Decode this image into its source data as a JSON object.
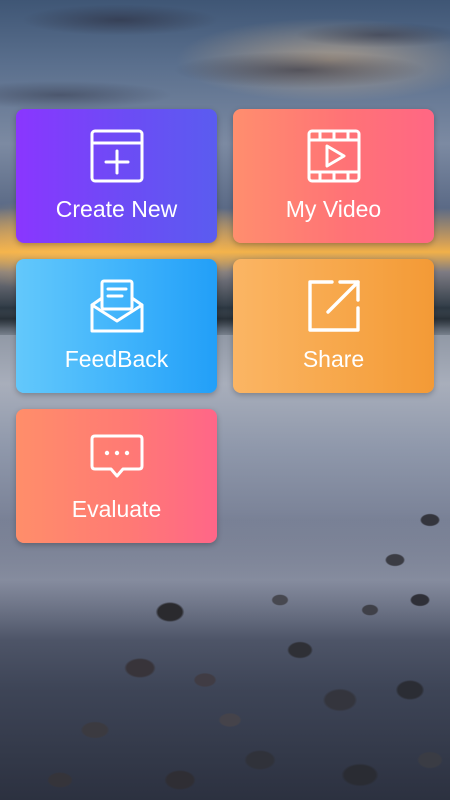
{
  "menu": {
    "tiles": [
      {
        "id": "create_new",
        "label": "Create New",
        "icon": "add-window-icon"
      },
      {
        "id": "my_video",
        "label": "My Video",
        "icon": "video-play-icon"
      },
      {
        "id": "feedback",
        "label": "FeedBack",
        "icon": "mail-icon"
      },
      {
        "id": "share",
        "label": "Share",
        "icon": "share-external-icon"
      },
      {
        "id": "evaluate",
        "label": "Evaluate",
        "icon": "chat-bubble-icon"
      }
    ]
  },
  "colors": {
    "create_new": [
      "#8a36ff",
      "#5a5cf0"
    ],
    "my_video": [
      "#ff8e6e",
      "#ff6784"
    ],
    "feedback": [
      "#63c8fb",
      "#229ff8"
    ],
    "share": [
      "#fbb564",
      "#f39a36"
    ],
    "evaluate": [
      "#ff8e6a",
      "#ff6688"
    ]
  }
}
